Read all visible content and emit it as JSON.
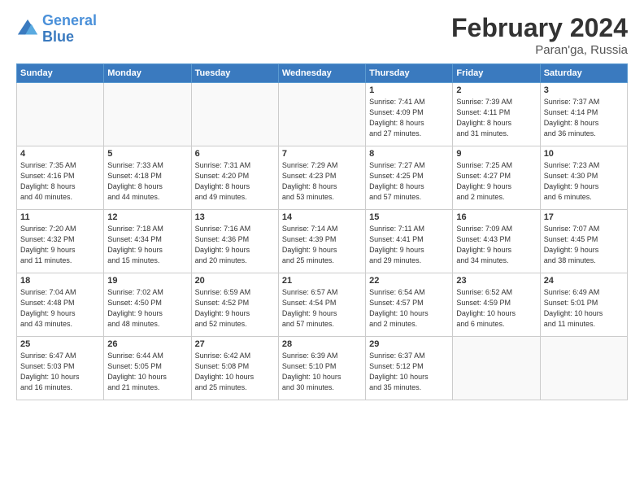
{
  "logo": {
    "line1": "General",
    "line2": "Blue"
  },
  "title": {
    "month": "February 2024",
    "location": "Paran'ga, Russia"
  },
  "weekdays": [
    "Sunday",
    "Monday",
    "Tuesday",
    "Wednesday",
    "Thursday",
    "Friday",
    "Saturday"
  ],
  "weeks": [
    [
      {
        "day": "",
        "detail": ""
      },
      {
        "day": "",
        "detail": ""
      },
      {
        "day": "",
        "detail": ""
      },
      {
        "day": "",
        "detail": ""
      },
      {
        "day": "1",
        "detail": "Sunrise: 7:41 AM\nSunset: 4:09 PM\nDaylight: 8 hours\nand 27 minutes."
      },
      {
        "day": "2",
        "detail": "Sunrise: 7:39 AM\nSunset: 4:11 PM\nDaylight: 8 hours\nand 31 minutes."
      },
      {
        "day": "3",
        "detail": "Sunrise: 7:37 AM\nSunset: 4:14 PM\nDaylight: 8 hours\nand 36 minutes."
      }
    ],
    [
      {
        "day": "4",
        "detail": "Sunrise: 7:35 AM\nSunset: 4:16 PM\nDaylight: 8 hours\nand 40 minutes."
      },
      {
        "day": "5",
        "detail": "Sunrise: 7:33 AM\nSunset: 4:18 PM\nDaylight: 8 hours\nand 44 minutes."
      },
      {
        "day": "6",
        "detail": "Sunrise: 7:31 AM\nSunset: 4:20 PM\nDaylight: 8 hours\nand 49 minutes."
      },
      {
        "day": "7",
        "detail": "Sunrise: 7:29 AM\nSunset: 4:23 PM\nDaylight: 8 hours\nand 53 minutes."
      },
      {
        "day": "8",
        "detail": "Sunrise: 7:27 AM\nSunset: 4:25 PM\nDaylight: 8 hours\nand 57 minutes."
      },
      {
        "day": "9",
        "detail": "Sunrise: 7:25 AM\nSunset: 4:27 PM\nDaylight: 9 hours\nand 2 minutes."
      },
      {
        "day": "10",
        "detail": "Sunrise: 7:23 AM\nSunset: 4:30 PM\nDaylight: 9 hours\nand 6 minutes."
      }
    ],
    [
      {
        "day": "11",
        "detail": "Sunrise: 7:20 AM\nSunset: 4:32 PM\nDaylight: 9 hours\nand 11 minutes."
      },
      {
        "day": "12",
        "detail": "Sunrise: 7:18 AM\nSunset: 4:34 PM\nDaylight: 9 hours\nand 15 minutes."
      },
      {
        "day": "13",
        "detail": "Sunrise: 7:16 AM\nSunset: 4:36 PM\nDaylight: 9 hours\nand 20 minutes."
      },
      {
        "day": "14",
        "detail": "Sunrise: 7:14 AM\nSunset: 4:39 PM\nDaylight: 9 hours\nand 25 minutes."
      },
      {
        "day": "15",
        "detail": "Sunrise: 7:11 AM\nSunset: 4:41 PM\nDaylight: 9 hours\nand 29 minutes."
      },
      {
        "day": "16",
        "detail": "Sunrise: 7:09 AM\nSunset: 4:43 PM\nDaylight: 9 hours\nand 34 minutes."
      },
      {
        "day": "17",
        "detail": "Sunrise: 7:07 AM\nSunset: 4:45 PM\nDaylight: 9 hours\nand 38 minutes."
      }
    ],
    [
      {
        "day": "18",
        "detail": "Sunrise: 7:04 AM\nSunset: 4:48 PM\nDaylight: 9 hours\nand 43 minutes."
      },
      {
        "day": "19",
        "detail": "Sunrise: 7:02 AM\nSunset: 4:50 PM\nDaylight: 9 hours\nand 48 minutes."
      },
      {
        "day": "20",
        "detail": "Sunrise: 6:59 AM\nSunset: 4:52 PM\nDaylight: 9 hours\nand 52 minutes."
      },
      {
        "day": "21",
        "detail": "Sunrise: 6:57 AM\nSunset: 4:54 PM\nDaylight: 9 hours\nand 57 minutes."
      },
      {
        "day": "22",
        "detail": "Sunrise: 6:54 AM\nSunset: 4:57 PM\nDaylight: 10 hours\nand 2 minutes."
      },
      {
        "day": "23",
        "detail": "Sunrise: 6:52 AM\nSunset: 4:59 PM\nDaylight: 10 hours\nand 6 minutes."
      },
      {
        "day": "24",
        "detail": "Sunrise: 6:49 AM\nSunset: 5:01 PM\nDaylight: 10 hours\nand 11 minutes."
      }
    ],
    [
      {
        "day": "25",
        "detail": "Sunrise: 6:47 AM\nSunset: 5:03 PM\nDaylight: 10 hours\nand 16 minutes."
      },
      {
        "day": "26",
        "detail": "Sunrise: 6:44 AM\nSunset: 5:05 PM\nDaylight: 10 hours\nand 21 minutes."
      },
      {
        "day": "27",
        "detail": "Sunrise: 6:42 AM\nSunset: 5:08 PM\nDaylight: 10 hours\nand 25 minutes."
      },
      {
        "day": "28",
        "detail": "Sunrise: 6:39 AM\nSunset: 5:10 PM\nDaylight: 10 hours\nand 30 minutes."
      },
      {
        "day": "29",
        "detail": "Sunrise: 6:37 AM\nSunset: 5:12 PM\nDaylight: 10 hours\nand 35 minutes."
      },
      {
        "day": "",
        "detail": ""
      },
      {
        "day": "",
        "detail": ""
      }
    ]
  ]
}
